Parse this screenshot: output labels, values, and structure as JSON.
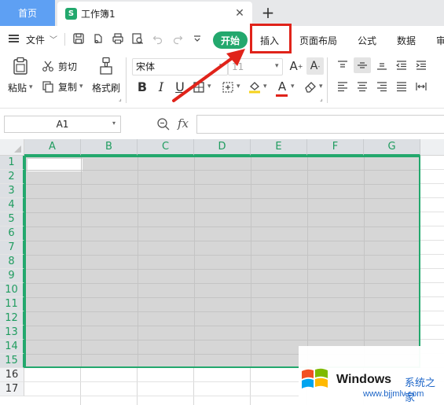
{
  "titlebar": {
    "home_tab": "首页",
    "doc_icon_letter": "S",
    "doc_tab": "工作簿1",
    "close_glyph": "✕",
    "add_glyph": "+"
  },
  "menubar": {
    "file_label": "文件",
    "tabs": [
      {
        "label": "开始",
        "active": true
      },
      {
        "label": "插入",
        "highlighted": true
      },
      {
        "label": "页面布局"
      },
      {
        "label": "公式"
      },
      {
        "label": "数据"
      },
      {
        "label": "审"
      }
    ]
  },
  "ribbon": {
    "paste_label": "粘贴",
    "cut_label": "剪切",
    "copy_label": "复制",
    "format_painter_label": "格式刷",
    "font_name": "宋体",
    "font_size": "11",
    "bold_label": "B",
    "italic_label": "I",
    "underline_label": "U",
    "font_color_label": "A"
  },
  "formula": {
    "cell_ref": "A1",
    "fx_label": "fx",
    "value": ""
  },
  "sheet": {
    "columns": [
      "A",
      "B",
      "C",
      "D",
      "E",
      "F",
      "G"
    ],
    "rows": [
      "1",
      "2",
      "3",
      "4",
      "5",
      "6",
      "7",
      "8",
      "9",
      "10",
      "11",
      "12",
      "13",
      "14",
      "15",
      "16",
      "17"
    ],
    "selected_rows": 15,
    "selected_cols": 7,
    "accent": "#23a86d",
    "annotation_color": "#e0231a"
  },
  "watermark": {
    "brand": "Windows",
    "cn_text": "系统之家",
    "url": "www.bjjmlv.com"
  }
}
